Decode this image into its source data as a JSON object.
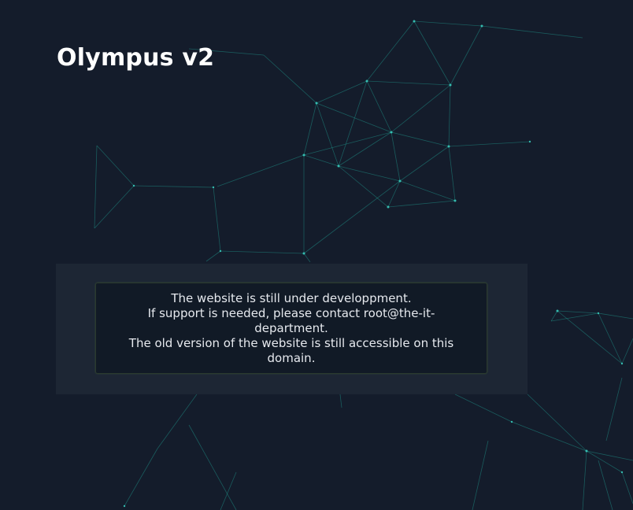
{
  "header": {
    "title": "Olympus v2"
  },
  "notice": {
    "lines": [
      "The website is still under developpment.",
      "If support is needed, please contact root@the-it-department.",
      "The old version of the website is still accessible on this domain."
    ]
  },
  "background": {
    "style": "particle-network",
    "line_color": "#1f8f86",
    "node_color": "#3bd1c2",
    "base_color": "#141c2b"
  }
}
